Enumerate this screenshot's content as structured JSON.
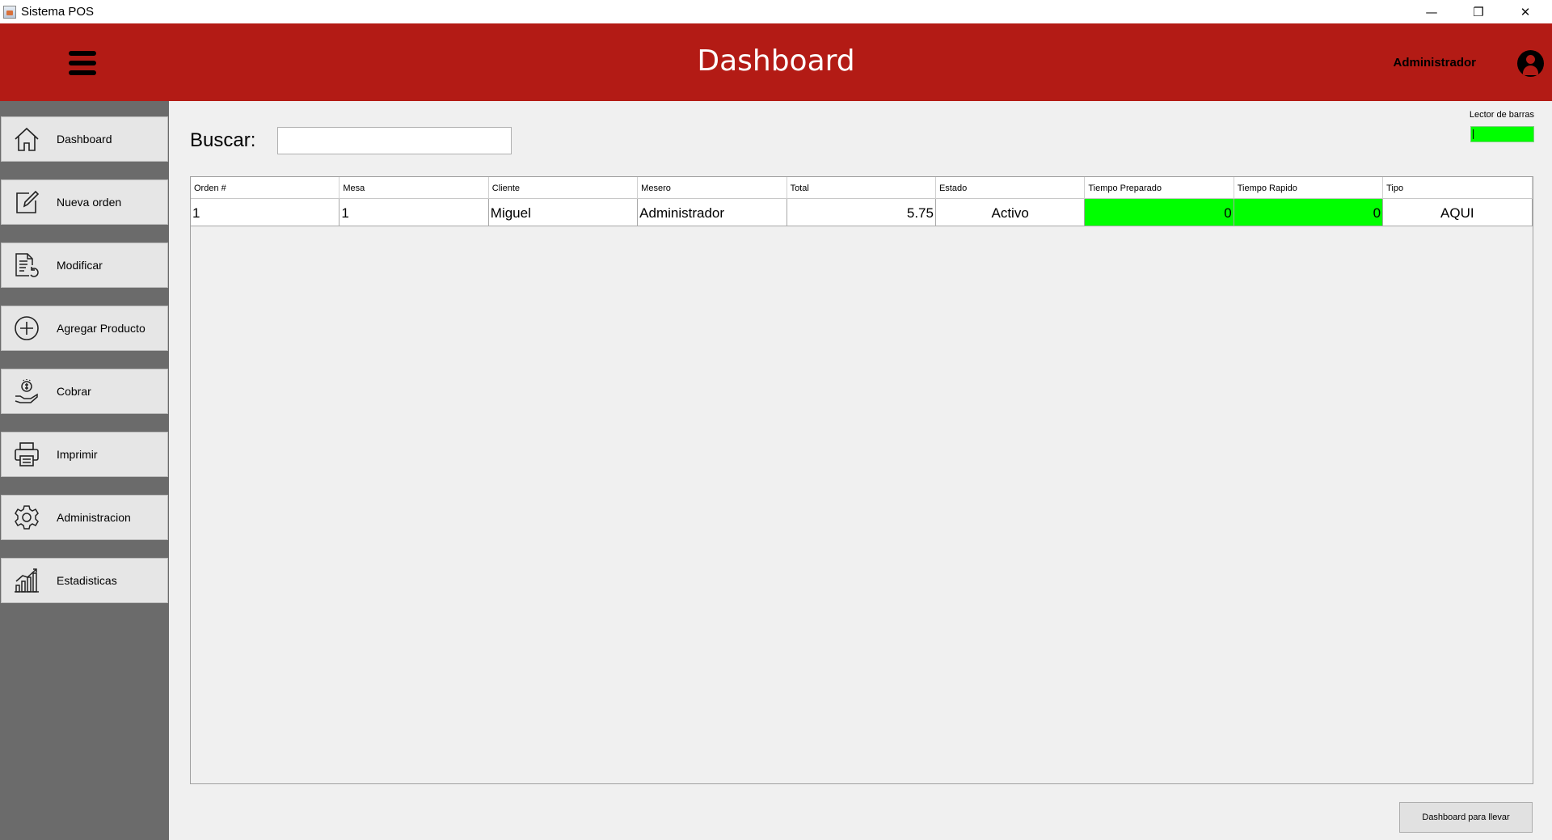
{
  "window": {
    "title": "Sistema POS",
    "controls": {
      "minimize": "—",
      "restore": "❐",
      "close": "✕"
    }
  },
  "header": {
    "title": "Dashboard",
    "user": "Administrador",
    "bg_color": "#b31b15"
  },
  "sidebar": {
    "items": [
      {
        "label": "Dashboard",
        "icon": "home-icon"
      },
      {
        "label": "Nueva orden",
        "icon": "edit-icon"
      },
      {
        "label": "Modificar",
        "icon": "document-refresh-icon"
      },
      {
        "label": "Agregar Producto",
        "icon": "plus-circle-icon"
      },
      {
        "label": "Cobrar",
        "icon": "hand-coin-icon"
      },
      {
        "label": "Imprimir",
        "icon": "printer-icon"
      },
      {
        "label": "Administracion",
        "icon": "gear-icon"
      },
      {
        "label": "Estadisticas",
        "icon": "chart-icon"
      }
    ]
  },
  "search": {
    "label": "Buscar:",
    "value": ""
  },
  "barcode": {
    "label": "Lector de barras",
    "color": "#00ff00"
  },
  "table": {
    "columns": [
      "Orden #",
      "Mesa",
      "Cliente",
      "Mesero",
      "Total",
      "Estado",
      "Tiempo Preparado",
      "Tiempo Rapido",
      "Tipo"
    ],
    "rows": [
      {
        "orden": "1",
        "mesa": "1",
        "cliente": "Miguel",
        "mesero": "Administrador",
        "total": "5.75",
        "estado": "Activo",
        "tiempo_preparado": "0",
        "tiempo_rapido": "0",
        "tipo": "AQUI"
      }
    ],
    "highlight_color": "#00ff00"
  },
  "footer": {
    "button_label": "Dashboard para llevar"
  }
}
